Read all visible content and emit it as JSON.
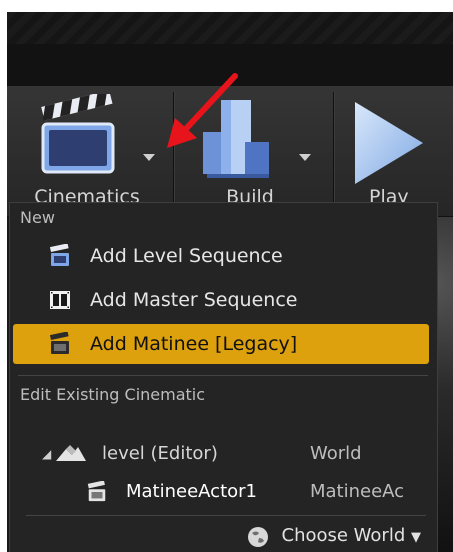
{
  "toolbar": {
    "cinematics_label": "Cinematics",
    "build_label": "Build",
    "play_label": "Play"
  },
  "menu": {
    "section_new": "New",
    "items": [
      {
        "label": "Add Level Sequence",
        "icon": "clapperboard-icon"
      },
      {
        "label": "Add Master Sequence",
        "icon": "film-strip-icon"
      },
      {
        "label": "Add Matinee [Legacy]",
        "icon": "clapperboard-icon",
        "highlighted": true
      }
    ],
    "section_edit": "Edit Existing Cinematic",
    "tree": [
      {
        "name": "level (Editor)",
        "type": "World",
        "icon": "level-icon"
      },
      {
        "name": "MatineeActor1",
        "type": "MatineeAc",
        "icon": "clapperboard-icon"
      }
    ],
    "choose_world": "Choose World"
  },
  "colors": {
    "highlight": "#dca10c",
    "menu_bg": "#242424",
    "annotation_arrow": "#e8141b"
  }
}
